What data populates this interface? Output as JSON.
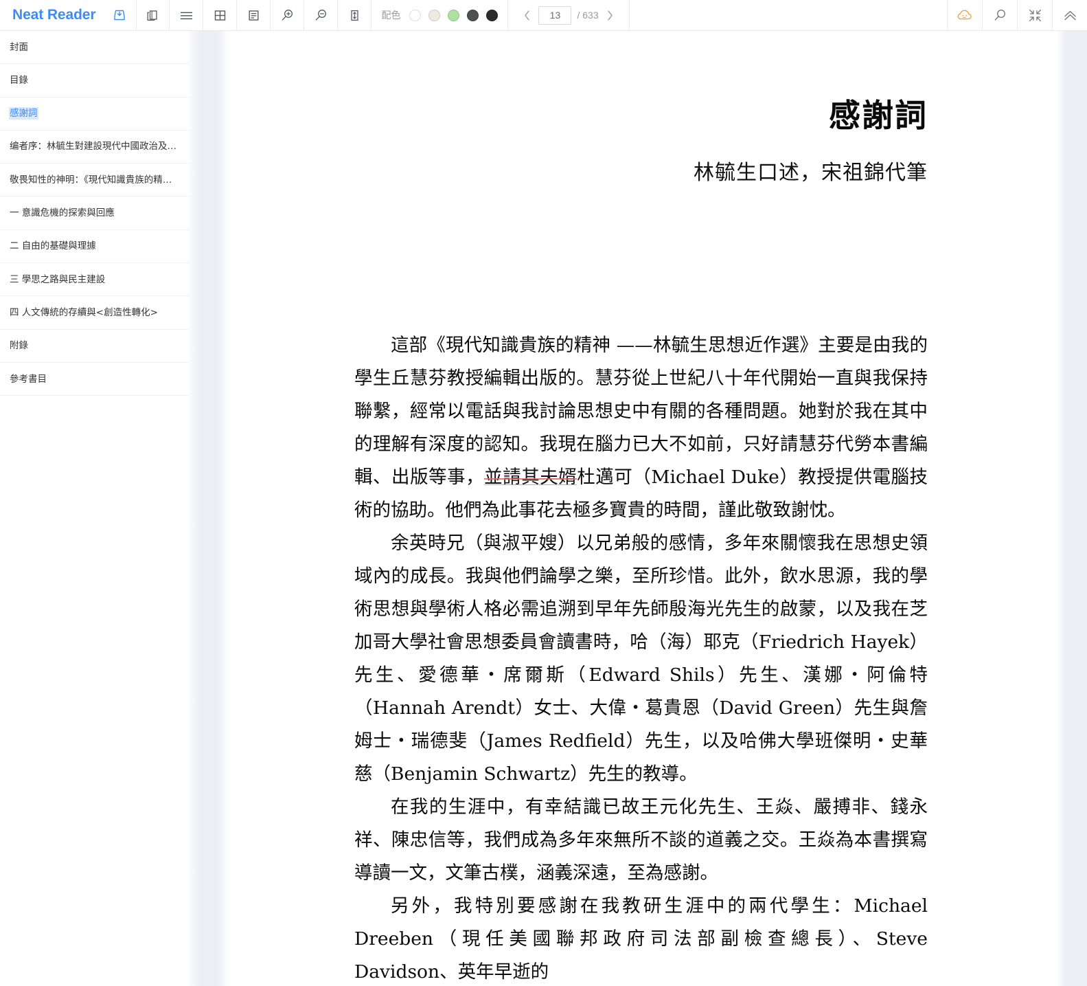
{
  "app": {
    "brand": "Neat Reader"
  },
  "toolbar": {
    "save_icon": "save-to-shelf-icon",
    "copy_icon": "duplicate-pages-icon",
    "list_icon": "hamburger-list-icon",
    "grid_icon": "grid-layout-icon",
    "text_icon": "text-align-icon",
    "zoom_in_icon": "zoom-in-icon",
    "zoom_out_icon": "zoom-out-icon",
    "line_height_icon": "line-height-icon",
    "scheme_label": "配色",
    "scheme_swatches": [
      {
        "name": "scheme-white",
        "color": "#ffffff"
      },
      {
        "name": "scheme-cream",
        "color": "#eeeadf"
      },
      {
        "name": "scheme-green",
        "color": "#aee0a2"
      },
      {
        "name": "scheme-gray",
        "color": "#4e5053"
      },
      {
        "name": "scheme-black",
        "color": "#2b2b2d"
      }
    ],
    "pager": {
      "prev_label": "‹",
      "current_page": "13",
      "total_label": "/ 633",
      "next_label": "›"
    },
    "right_icons": [
      {
        "name": "cloud-sync-icon",
        "color": "#f0a03c"
      },
      {
        "name": "search-icon",
        "color": "#767680"
      },
      {
        "name": "fit-to-screen-icon",
        "color": "#767680"
      },
      {
        "name": "collapse-toolbar-icon",
        "color": "#767680"
      }
    ]
  },
  "sidebar": {
    "items": [
      {
        "label": "封面",
        "active": false
      },
      {
        "label": "目錄",
        "active": false
      },
      {
        "label": "感謝詞",
        "active": true
      },
      {
        "label": "编者序：林毓生對建設現代中國政治及…",
        "active": false
      },
      {
        "label": "敬畏知性的神明：《現代知識貴族的精…",
        "active": false
      },
      {
        "label": "一 意識危機的探索與回應",
        "active": false
      },
      {
        "label": "二 自由的基礎與理據",
        "active": false
      },
      {
        "label": "三 學思之路與民主建設",
        "active": false
      },
      {
        "label": "四 人文傳統的存續與<創造性轉化>",
        "active": false
      },
      {
        "label": "附錄",
        "active": false
      },
      {
        "label": "參考書目",
        "active": false
      }
    ]
  },
  "page": {
    "title": "感謝詞",
    "subtitle": "林毓生口述，宋祖錦代筆",
    "paragraphs": {
      "p1_a": "這部《現代知識貴族的精神 ——林毓生思想近作選》主要是由我的學生丘慧芬教授編輯出版的。慧芬從上世紀八十年代開始一直與我保持聯繫，經常以電話與我討論思想史中有關的各種問題。她對於我在其中的理解有深度的認知。我現在腦力已大不如前，只好請慧芬代勞本書編輯、出版等事，",
      "p1_annotated": "並請其夫婿",
      "p1_b": "杜邁可（Michael Duke）教授提供電腦技術的協助。他們為此事花去極多寶貴的時間，謹此敬致謝忱。",
      "p2": "余英時兄（與淑平嫂）以兄弟般的感情，多年來關懷我在思想史領域內的成長。我與他們論學之樂，至所珍惜。此外，飲水思源，我的學術思想與學術人格必需追溯到早年先師殷海光先生的啟蒙，以及我在芝加哥大學社會思想委員會讀書時，哈（海）耶克（Friedrich Hayek）先生、愛德華‧席爾斯（Edward Shils）先生、漢娜‧阿倫特（Hannah Arendt）女士、大偉‧葛貴恩（David Green）先生與詹姆士‧瑞德斐（James Redfield）先生，以及哈佛大學班傑明‧史華慈（Benjamin Schwartz）先生的教導。",
      "p3": "在我的生涯中，有幸結識已故王元化先生、王焱、嚴搏非、錢永祥、陳忠信等，我們成為多年來無所不談的道義之交。王焱為本書撰寫導讀一文，文筆古樸，涵義深遠，至為感謝。",
      "p4": "另外，我特別要感謝在我教研生涯中的兩代學生：Michael Dreeben（現任美國聯邦政府司法部副檢查總長）、Steve Davidson、英年早逝的"
    }
  },
  "colors": {
    "brand": "#3b8cf4",
    "active_toc": "#3b8cf4",
    "active_toc_bg": "#d9e8fb",
    "annotation_red": "#e06464",
    "cloud_orange": "#f0a03c"
  }
}
